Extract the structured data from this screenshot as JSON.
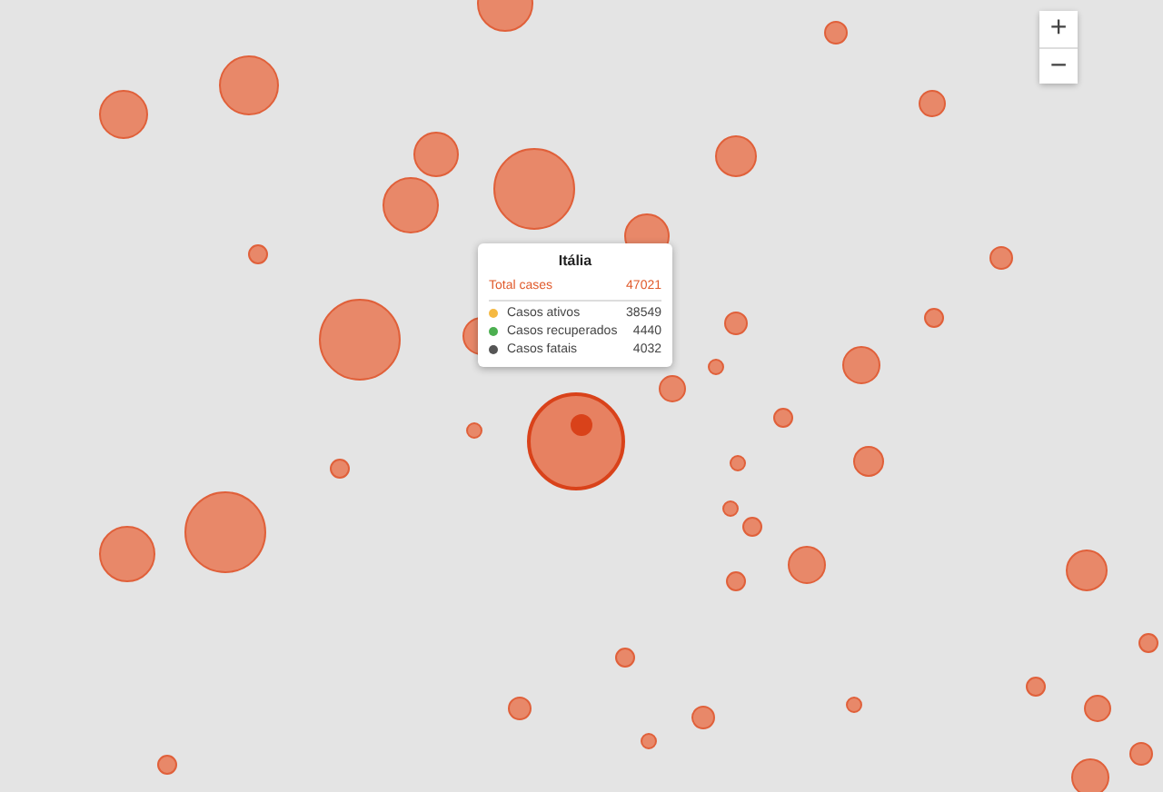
{
  "zoom_controls": {
    "zoom_in": "+",
    "zoom_out": "−"
  },
  "tooltip": {
    "title": "Itália",
    "total_label": "Total cases",
    "total_value": "47021",
    "rows": [
      {
        "label": "Casos ativos",
        "value": "38549",
        "color": "#f5b942"
      },
      {
        "label": "Casos recuperados",
        "value": "4440",
        "color": "#4caf50"
      },
      {
        "label": "Casos fatais",
        "value": "4032",
        "color": "#555555"
      }
    ]
  }
}
